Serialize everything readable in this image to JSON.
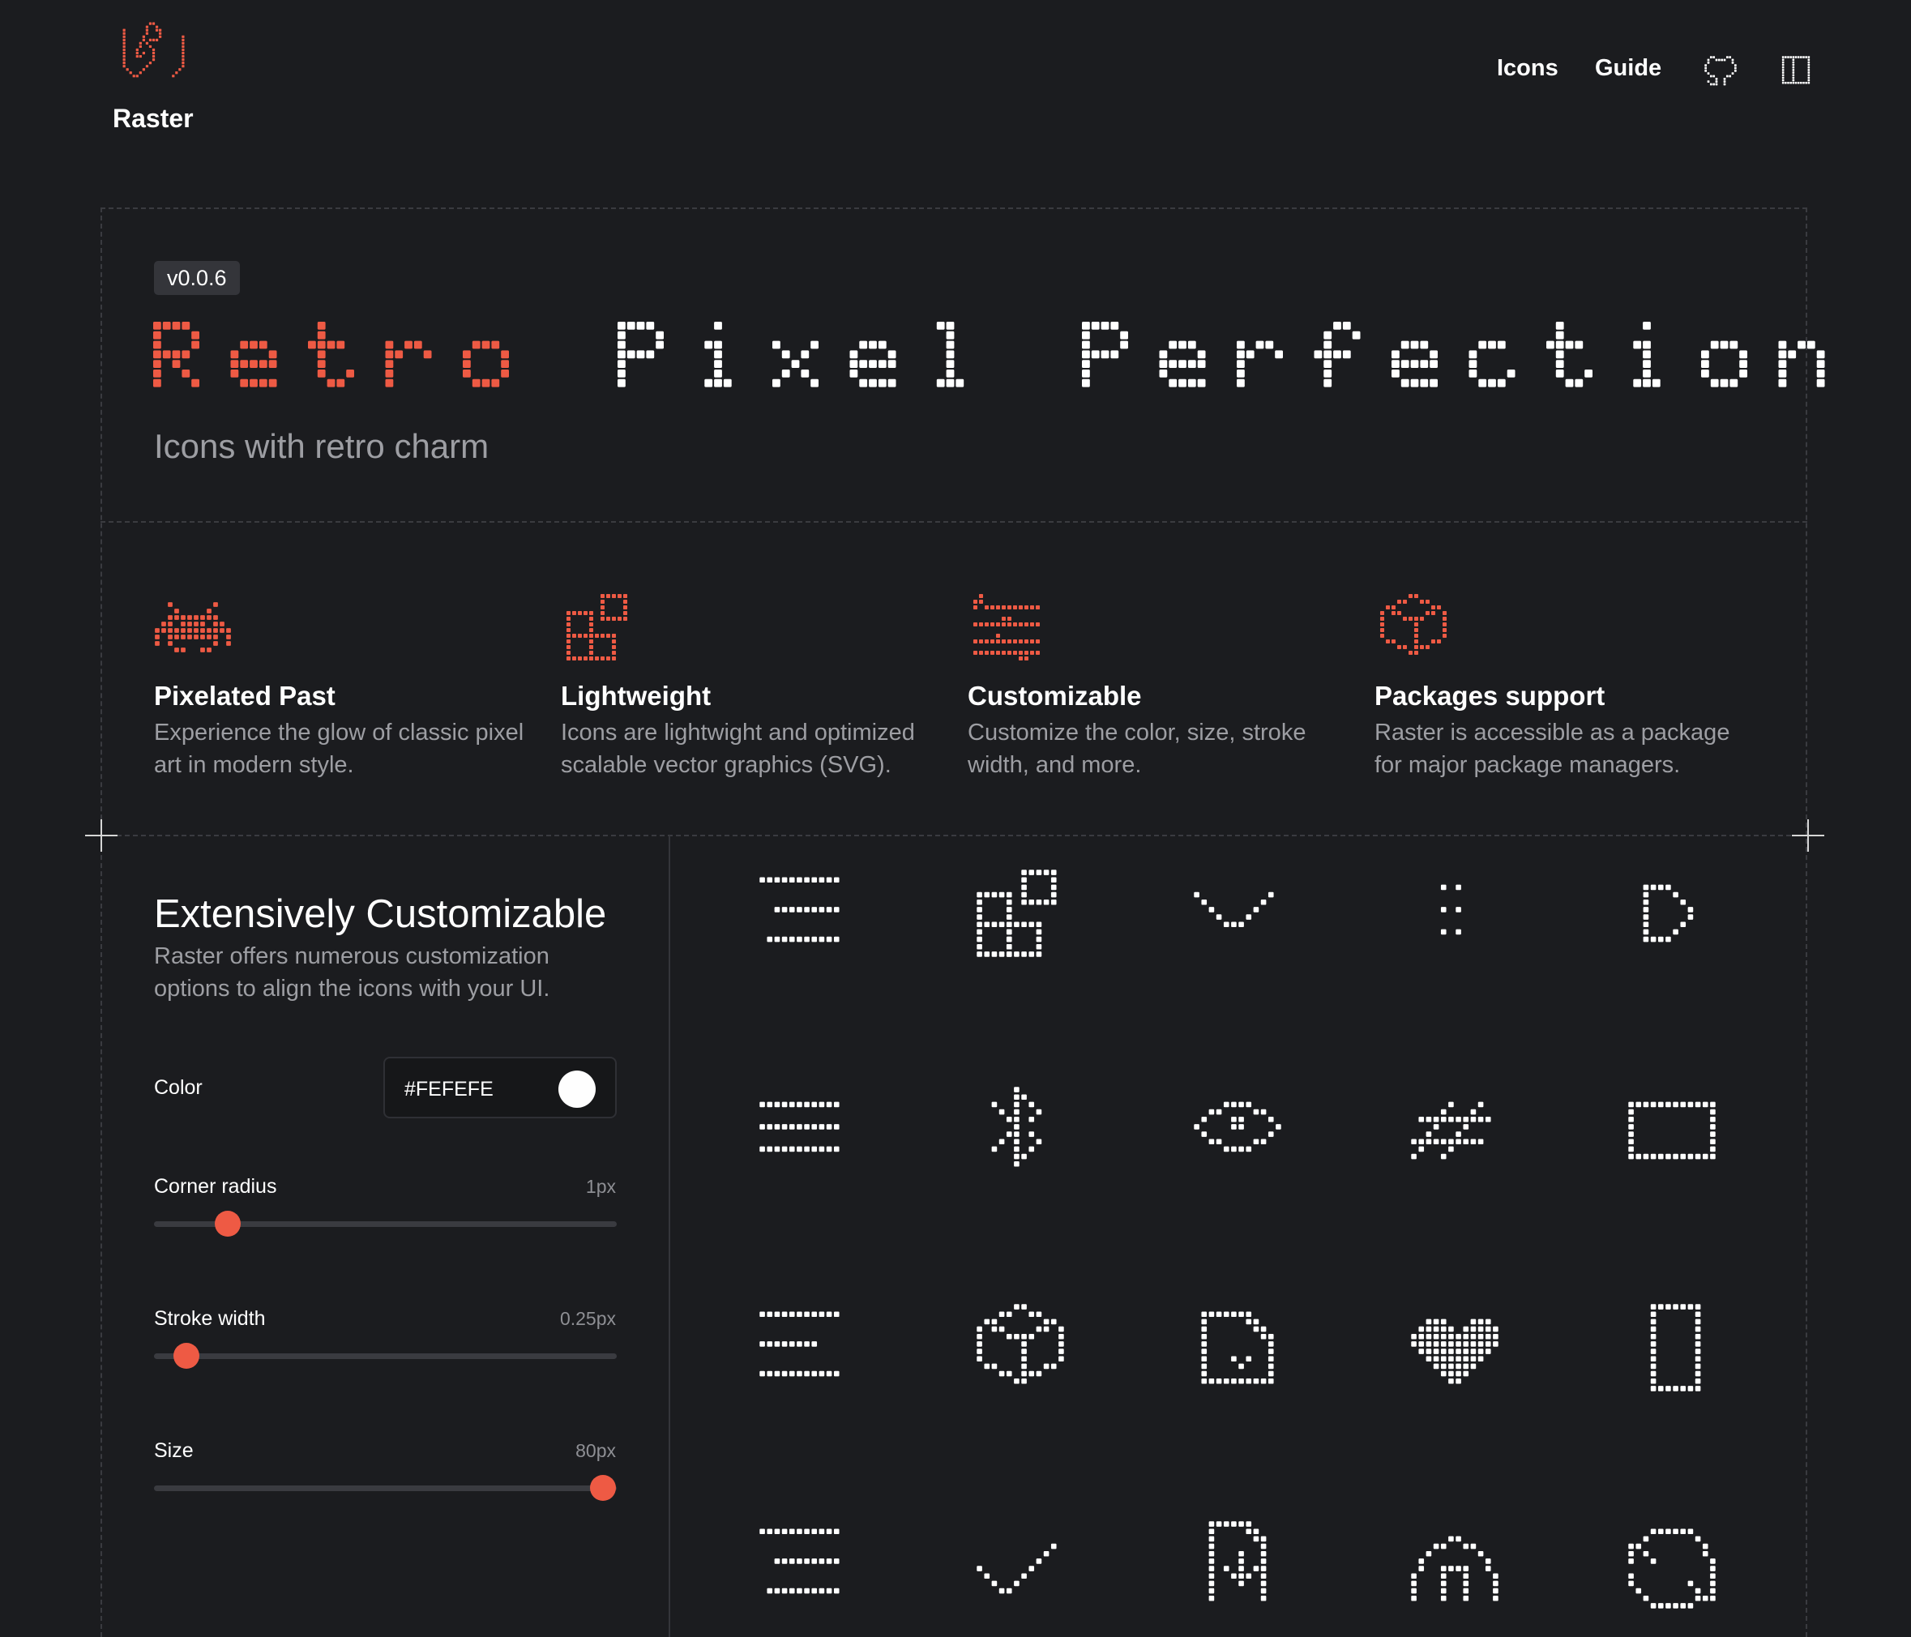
{
  "header": {
    "brand": "Raster",
    "nav": [
      {
        "label": "Icons"
      },
      {
        "label": "Guide"
      }
    ],
    "icons": [
      "logo-icon",
      "github-icon",
      "book-icon"
    ]
  },
  "hero": {
    "version": "v0.0.6",
    "headline_accent": "Retro",
    "headline_rest": "Pixel Perfection",
    "tagline": "Icons with retro charm"
  },
  "features": [
    {
      "icon": "space-invader-icon",
      "title": "Pixelated Past",
      "desc": "Experience the glow of classic pixel art in modern style."
    },
    {
      "icon": "blocks-icon",
      "title": "Lightweight",
      "desc": "Icons are lightwight and optimized scalable vector graphics (SVG)."
    },
    {
      "icon": "sliders-icon",
      "title": "Customizable",
      "desc": "Customize the color, size, stroke width, and more."
    },
    {
      "icon": "package-icon",
      "title": "Packages support",
      "desc": "Raster is accessible as a package for major package managers."
    }
  ],
  "customizer": {
    "title": "Extensively Customizable",
    "desc": "Raster offers numerous customization options to align the icons with your UI.",
    "color": {
      "label": "Color",
      "value": "#FEFEFE"
    },
    "corner_radius": {
      "label": "Corner radius",
      "value": "1px",
      "fraction": 0.16
    },
    "stroke_width": {
      "label": "Stroke width",
      "value": "0.25px",
      "fraction": 0.07
    },
    "size": {
      "label": "Size",
      "value": "80px",
      "fraction": 0.97
    }
  },
  "icon_grid": [
    "align-right-icon",
    "blocks-icon",
    "wave-icon",
    "grip-icon",
    "play-outline-icon",
    "justify-icon",
    "bluetooth-icon",
    "eye-icon",
    "hash-icon",
    "rectangle-icon",
    "align-left-icon",
    "package-icon",
    "file-icon",
    "heart-icon",
    "portrait-rectangle-icon",
    "align-right-icon",
    "check-icon",
    "file-download-icon",
    "home-icon",
    "refresh-icon"
  ],
  "colors": {
    "accent": "#ee5a44",
    "background": "#1b1c1f",
    "text": "#ffffff",
    "muted": "#9d9ea3"
  }
}
